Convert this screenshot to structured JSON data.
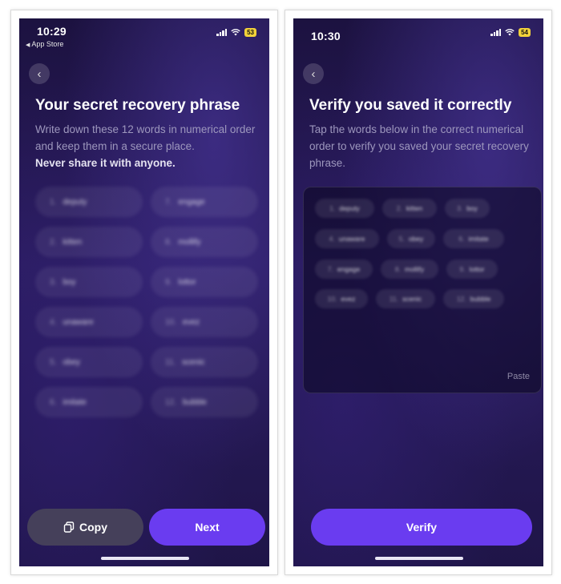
{
  "left": {
    "status": {
      "time": "10:29",
      "back_to_app": "App Store",
      "battery": "53"
    },
    "title": "Your secret recovery phrase",
    "description": "Write down these 12 words in numerical order and keep them in a secure place.",
    "warning": "Never share it with anyone.",
    "words": [
      {
        "num": "1.",
        "word": "deputy"
      },
      {
        "num": "7.",
        "word": "engage"
      },
      {
        "num": "2.",
        "word": "kitten"
      },
      {
        "num": "8.",
        "word": "mollify"
      },
      {
        "num": "3.",
        "word": "boy"
      },
      {
        "num": "9.",
        "word": "lottor"
      },
      {
        "num": "4.",
        "word": "unaware"
      },
      {
        "num": "10.",
        "word": "evez"
      },
      {
        "num": "5.",
        "word": "obey"
      },
      {
        "num": "11.",
        "word": "scenic"
      },
      {
        "num": "6.",
        "word": "imitate"
      },
      {
        "num": "12.",
        "word": "bubble"
      }
    ],
    "copy_label": "Copy",
    "next_label": "Next"
  },
  "right": {
    "status": {
      "time": "10:30",
      "battery": "54"
    },
    "title": "Verify you saved it correctly",
    "description": "Tap the words below in the correct numerical order to verify you saved your secret recovery phrase.",
    "words": [
      {
        "num": "1.",
        "word": "deputy"
      },
      {
        "num": "2.",
        "word": "kitten"
      },
      {
        "num": "3.",
        "word": "boy"
      },
      {
        "num": "4.",
        "word": "unaware"
      },
      {
        "num": "5.",
        "word": "obey"
      },
      {
        "num": "6.",
        "word": "imitate"
      },
      {
        "num": "7.",
        "word": "engage"
      },
      {
        "num": "8.",
        "word": "mollify"
      },
      {
        "num": "9.",
        "word": "lottor"
      },
      {
        "num": "10.",
        "word": "evez"
      },
      {
        "num": "11.",
        "word": "scenic"
      },
      {
        "num": "12.",
        "word": "bubble"
      }
    ],
    "paste_label": "Paste",
    "verify_label": "Verify"
  },
  "colors": {
    "accent": "#6a3cf0",
    "copy_bg": "#45405a",
    "battery": "#f2d23a"
  }
}
